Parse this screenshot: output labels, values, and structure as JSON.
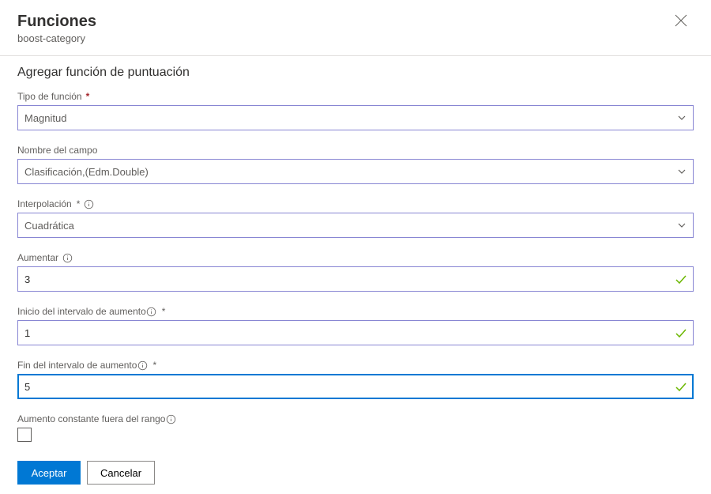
{
  "header": {
    "title": "Funciones",
    "subtitle": "boost-category"
  },
  "section_title": "Agregar función de puntuación",
  "fields": {
    "funcType": {
      "label": "Tipo de función",
      "value": "Magnitud"
    },
    "fieldName": {
      "label": "Nombre del campo",
      "value": "Clasificación,(Edm.Double)"
    },
    "interpolation": {
      "label": "Interpolación",
      "value": "Cuadrática"
    },
    "boost": {
      "label": "Aumentar",
      "value": "3"
    },
    "rangeStart": {
      "label": "Inicio del intervalo de aumento",
      "value": "1"
    },
    "rangeEnd": {
      "label": "Fin del intervalo de aumento",
      "value": "5"
    },
    "constantOutside": {
      "label": "Aumento constante fuera del rango"
    }
  },
  "buttons": {
    "accept": "Aceptar",
    "cancel": "Cancelar"
  }
}
